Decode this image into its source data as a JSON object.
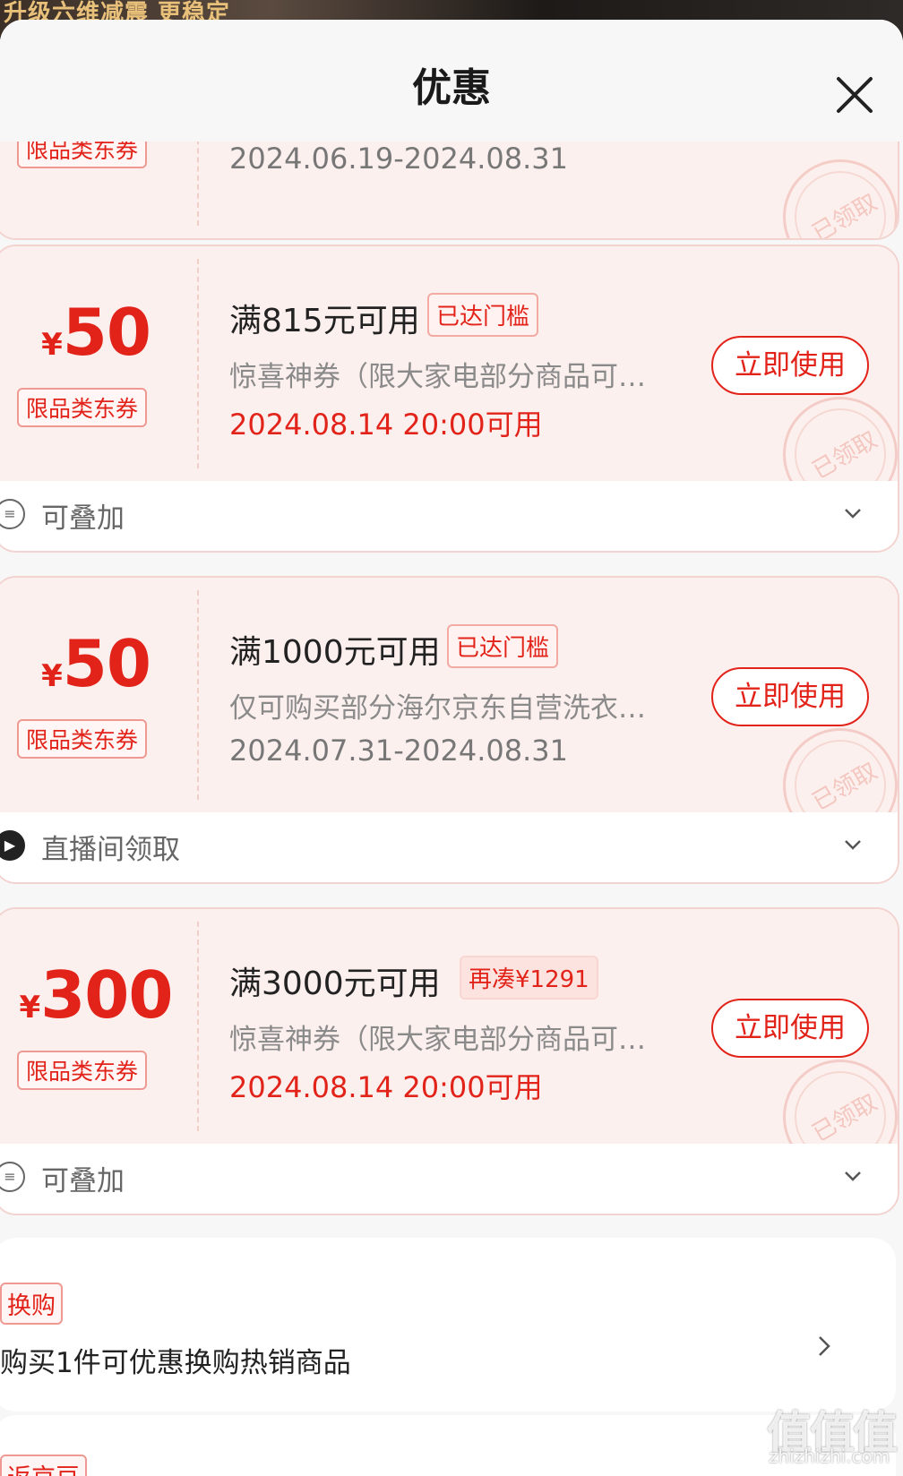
{
  "backdrop": {
    "text": "升级六维减震 更稳定"
  },
  "header": {
    "title": "优惠"
  },
  "partial_coupon": {
    "tag": "限品类东券",
    "date": "2024.06.19-2024.08.31",
    "stamp": "已领取"
  },
  "coupons": [
    {
      "currency": "¥",
      "amount": "50",
      "tag": "限品类东券",
      "condition": "满815元可用",
      "badge": "已达门槛",
      "desc": "惊喜神券（限大家电部分商品可用）",
      "date": "2024.08.14 20:00可用",
      "button": "立即使用",
      "stamp": "已领取",
      "footer_icon": "stack-icon",
      "footer": "可叠加"
    },
    {
      "currency": "¥",
      "amount": "50",
      "tag": "限品类东券",
      "condition": "满1000元可用",
      "badge": "已达门槛",
      "desc": "仅可购买部分海尔京东自营洗衣机商品",
      "date": "2024.07.31-2024.08.31",
      "button": "立即使用",
      "stamp": "已领取",
      "footer_icon": "live-icon",
      "footer": "直播间领取"
    },
    {
      "currency": "¥",
      "amount": "300",
      "tag": "限品类东券",
      "condition": "满3000元可用",
      "badge": "再凑¥1291",
      "desc": "惊喜神券（限大家电部分商品可用）",
      "date": "2024.08.14 20:00可用",
      "button": "立即使用",
      "stamp": "已领取",
      "footer_icon": "stack-icon",
      "footer": "可叠加"
    }
  ],
  "swap": {
    "tag": "换购",
    "text": "购买1件可优惠换购热销商品"
  },
  "next_section": {
    "tag": "返京豆"
  },
  "watermark": {
    "main": "值值值",
    "sub": "zhizhizhi.com"
  },
  "colors": {
    "accent": "#e2231a",
    "coupon_bg": "#fcf0ee",
    "sheet_bg": "#f7f7f7"
  }
}
